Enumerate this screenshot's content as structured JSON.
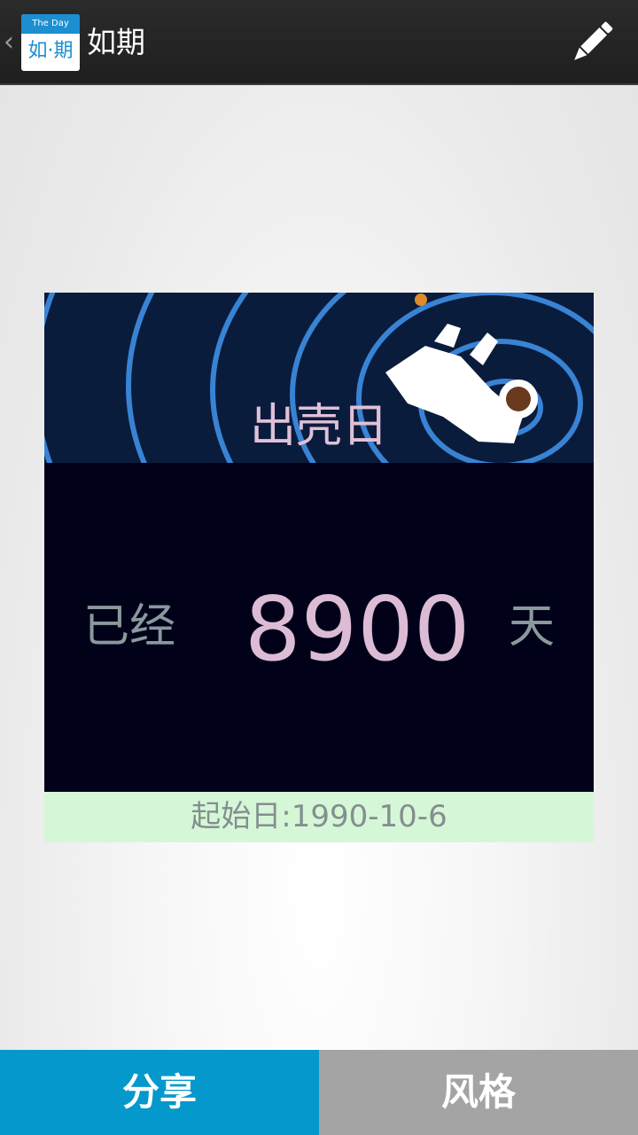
{
  "action_bar": {
    "back_icon": "chevron-left-icon",
    "logo_top": "The Day",
    "logo_bottom": "如·期",
    "title": "如期",
    "edit_icon": "pencil-icon"
  },
  "card": {
    "event_title": "出壳日",
    "label_already": "已经",
    "day_count": "8900",
    "label_days": "天",
    "start_date_text": "起始日:1990-10-6",
    "banner_image": "astronaut-spiral-illustration"
  },
  "buttons": {
    "share_label": "分享",
    "style_label": "风格"
  },
  "colors": {
    "action_bar": "#222222",
    "accent_blue": "#0498cc",
    "gray_button": "#a4a4a4",
    "card_body": "#01021a",
    "card_footer": "#d6f7d7",
    "count_text": "#dcbcd4"
  }
}
